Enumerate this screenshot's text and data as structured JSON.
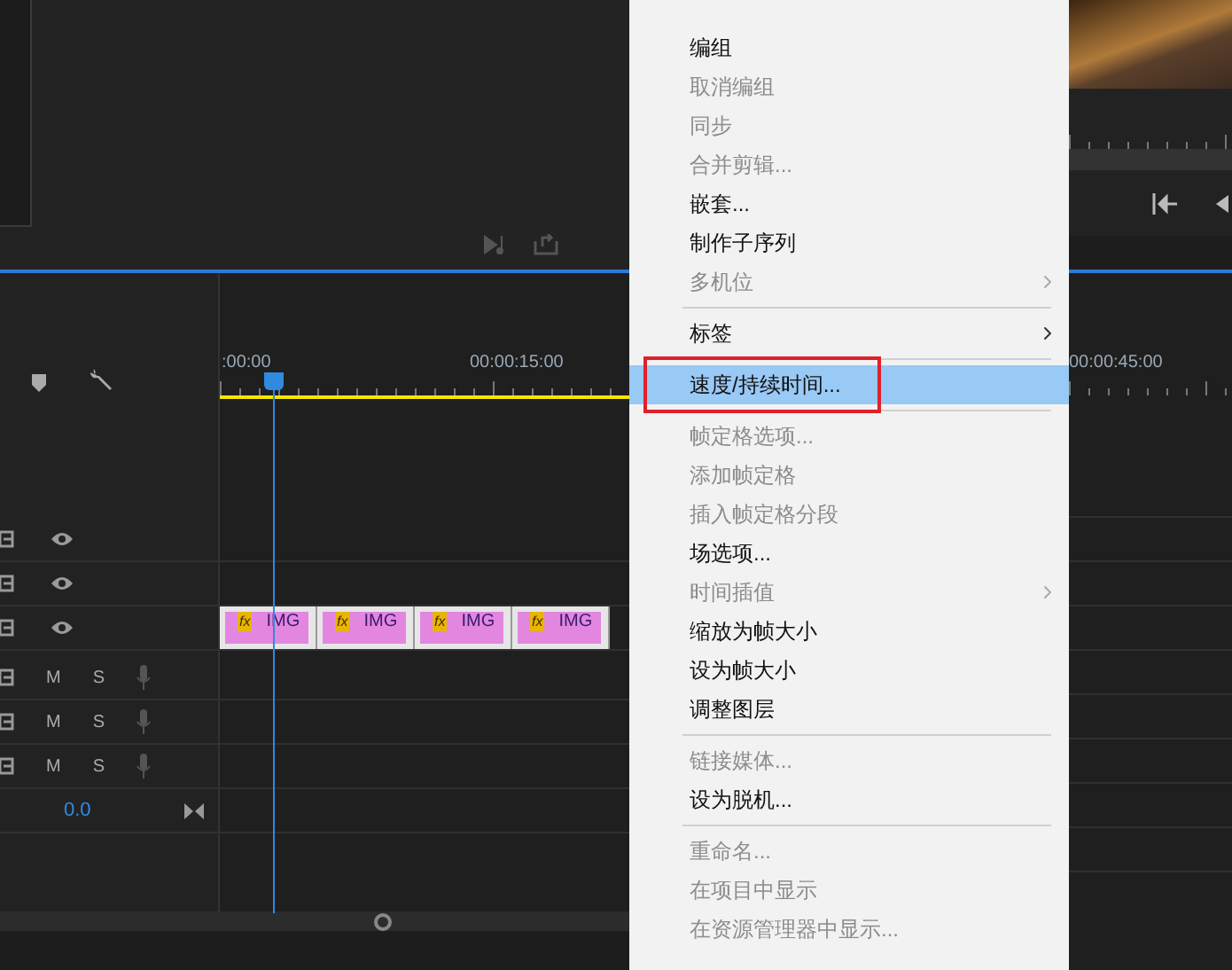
{
  "timeline": {
    "ruler_labels": [
      ":00:00",
      "00:00:15:00"
    ],
    "video_tracks": [
      {
        "kind": "empty"
      },
      {
        "kind": "empty"
      },
      {
        "kind": "clips",
        "clips": [
          {
            "badge": "fx",
            "label": "IMG"
          },
          {
            "badge": "fx",
            "label": "IMG"
          },
          {
            "badge": "fx",
            "label": "IMG"
          },
          {
            "badge": "fx",
            "label": "IMG"
          }
        ]
      }
    ],
    "audio_tracks": [
      {
        "mute": "M",
        "solo": "S"
      },
      {
        "mute": "M",
        "solo": "S"
      },
      {
        "mute": "M",
        "solo": "S"
      }
    ],
    "master": {
      "value": "0.0"
    }
  },
  "context_menu": {
    "items": [
      {
        "kind": "item",
        "label": "编组",
        "disabled": false,
        "submenu": false,
        "selected": false,
        "callout": false
      },
      {
        "kind": "item",
        "label": "取消编组",
        "disabled": true,
        "submenu": false,
        "selected": false,
        "callout": false
      },
      {
        "kind": "item",
        "label": "同步",
        "disabled": true,
        "submenu": false,
        "selected": false,
        "callout": false
      },
      {
        "kind": "item",
        "label": "合并剪辑...",
        "disabled": true,
        "submenu": false,
        "selected": false,
        "callout": false
      },
      {
        "kind": "item",
        "label": "嵌套...",
        "disabled": false,
        "submenu": false,
        "selected": false,
        "callout": false
      },
      {
        "kind": "item",
        "label": "制作子序列",
        "disabled": false,
        "submenu": false,
        "selected": false,
        "callout": false
      },
      {
        "kind": "item",
        "label": "多机位",
        "disabled": true,
        "submenu": true,
        "selected": false,
        "callout": false
      },
      {
        "kind": "separator"
      },
      {
        "kind": "item",
        "label": "标签",
        "disabled": false,
        "submenu": true,
        "selected": false,
        "callout": false
      },
      {
        "kind": "separator"
      },
      {
        "kind": "item",
        "label": "速度/持续时间...",
        "disabled": false,
        "submenu": false,
        "selected": true,
        "callout": true
      },
      {
        "kind": "separator"
      },
      {
        "kind": "item",
        "label": "帧定格选项...",
        "disabled": true,
        "submenu": false,
        "selected": false,
        "callout": false
      },
      {
        "kind": "item",
        "label": "添加帧定格",
        "disabled": true,
        "submenu": false,
        "selected": false,
        "callout": false
      },
      {
        "kind": "item",
        "label": "插入帧定格分段",
        "disabled": true,
        "submenu": false,
        "selected": false,
        "callout": false
      },
      {
        "kind": "item",
        "label": "场选项...",
        "disabled": false,
        "submenu": false,
        "selected": false,
        "callout": false
      },
      {
        "kind": "item",
        "label": "时间插值",
        "disabled": true,
        "submenu": true,
        "selected": false,
        "callout": false
      },
      {
        "kind": "item",
        "label": "缩放为帧大小",
        "disabled": false,
        "submenu": false,
        "selected": false,
        "callout": false
      },
      {
        "kind": "item",
        "label": "设为帧大小",
        "disabled": false,
        "submenu": false,
        "selected": false,
        "callout": false
      },
      {
        "kind": "item",
        "label": "调整图层",
        "disabled": false,
        "submenu": false,
        "selected": false,
        "callout": false
      },
      {
        "kind": "separator"
      },
      {
        "kind": "item",
        "label": "链接媒体...",
        "disabled": true,
        "submenu": false,
        "selected": false,
        "callout": false
      },
      {
        "kind": "item",
        "label": "设为脱机...",
        "disabled": false,
        "submenu": false,
        "selected": false,
        "callout": false
      },
      {
        "kind": "separator"
      },
      {
        "kind": "item",
        "label": "重命名...",
        "disabled": true,
        "submenu": false,
        "selected": false,
        "callout": false
      },
      {
        "kind": "item",
        "label": "在项目中显示",
        "disabled": true,
        "submenu": false,
        "selected": false,
        "callout": false
      },
      {
        "kind": "item",
        "label": "在资源管理器中显示...",
        "disabled": true,
        "submenu": false,
        "selected": false,
        "callout": false
      }
    ]
  },
  "program_monitor": {
    "ruler_label": "00:00:45:00"
  }
}
